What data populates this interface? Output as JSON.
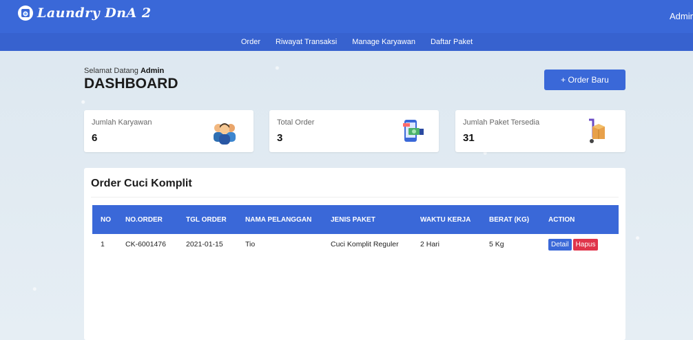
{
  "header": {
    "logo_text": "Laundry DnA 2",
    "user": "Admin"
  },
  "nav": {
    "items": [
      {
        "label": "Order"
      },
      {
        "label": "Riwayat Transaksi"
      },
      {
        "label": "Manage Karyawan"
      },
      {
        "label": "Daftar Paket"
      }
    ]
  },
  "welcome": {
    "greeting": "Selamat Datang",
    "name": "Admin",
    "title": "DASHBOARD",
    "new_order_label": "+ Order Baru"
  },
  "cards": [
    {
      "label": "Jumlah Karyawan",
      "value": "6",
      "icon": "employees-icon"
    },
    {
      "label": "Total Order",
      "value": "3",
      "icon": "payment-icon"
    },
    {
      "label": "Jumlah Paket Tersedia",
      "value": "31",
      "icon": "package-trolley-icon"
    }
  ],
  "orders": {
    "title": "Order Cuci Komplit",
    "columns": [
      "NO",
      "NO.ORDER",
      "TGL ORDER",
      "NAMA PELANGGAN",
      "JENIS PAKET",
      "WAKTU KERJA",
      "BERAT (KG)",
      "ACTION"
    ],
    "rows": [
      {
        "no": "1",
        "order_no": "CK-6001476",
        "date": "2021-01-15",
        "customer": "Tio",
        "package": "Cuci Komplit Reguler",
        "duration": "2 Hari",
        "weight": "5 Kg",
        "detail_label": "Detail",
        "delete_label": "Hapus"
      }
    ]
  },
  "colors": {
    "primary": "#3a68d8",
    "danger": "#e0344a"
  }
}
